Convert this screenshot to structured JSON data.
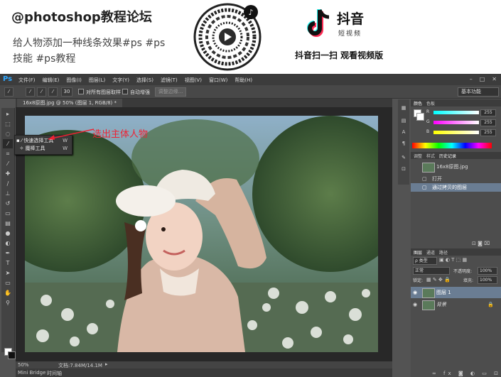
{
  "banner": {
    "title": "@photoshop教程论坛",
    "line1": "给人物添加一种线条效果#ps #ps",
    "line2": "技能 #ps教程",
    "tiktok_name": "抖音",
    "tiktok_sub": "短视频",
    "tiktok_cta": "抖音扫一扫 观看视频版",
    "brand_colors": {
      "cyan": "#25f4ee",
      "red": "#fe2c55"
    }
  },
  "ps": {
    "logo": "Ps",
    "menu": [
      "文件(F)",
      "编辑(E)",
      "图像(I)",
      "图层(L)",
      "文字(Y)",
      "选择(S)",
      "滤镜(T)",
      "视图(V)",
      "窗口(W)",
      "帮助(H)"
    ],
    "window_controls": [
      "–",
      "□",
      "✕"
    ],
    "options": {
      "brush_size": "30",
      "sample_all_layers": "对所有图层取样",
      "auto_enhance": "自动增强",
      "refine_edge": "调整边缘...",
      "workspace": "基本功能"
    },
    "doc_tab": "16x8原图.jpg @ 50% (图层 1, RGB/8) *",
    "flyout": [
      {
        "label": "快速选择工具",
        "key": "W"
      },
      {
        "label": "魔棒工具",
        "key": "W"
      }
    ],
    "callout": "选出主体人物",
    "status": {
      "zoom": "50%",
      "doc": "文档:7.84M/14.1M"
    },
    "bottom_tabs": [
      "Mini Bridge",
      "时间轴"
    ],
    "color_panel": {
      "tabs": [
        "颜色",
        "色板"
      ],
      "channels": [
        {
          "label": "R",
          "value": "255"
        },
        {
          "label": "G",
          "value": "255"
        },
        {
          "label": "B",
          "value": "255"
        }
      ]
    },
    "history_panel": {
      "tabs": [
        "调整",
        "样式",
        "历史记录"
      ],
      "snapshot": "16x8原图.jpg",
      "items": [
        "打开",
        "通过拷贝的图层"
      ]
    },
    "layers_panel": {
      "tabs": [
        "图层",
        "通道",
        "路径"
      ],
      "kind": "ρ 类型",
      "blend": "正常",
      "opacity_label": "不透明度:",
      "opacity": "100%",
      "lock_label": "锁定:",
      "fill_label": "填充:",
      "fill": "100%",
      "layers": [
        {
          "name": "图层 1",
          "selected": true
        },
        {
          "name": "背景",
          "selected": false
        }
      ]
    }
  }
}
